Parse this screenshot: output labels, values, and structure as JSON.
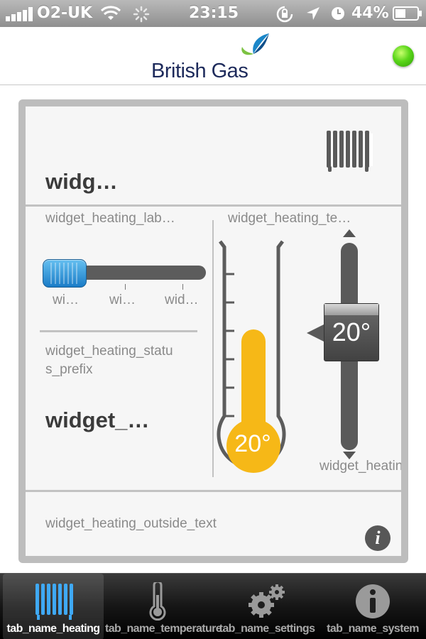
{
  "status_bar": {
    "carrier": "O2-UK",
    "time": "23:15",
    "battery": "44%"
  },
  "header": {
    "brand": "British Gas",
    "connection_color": "#5bd61a"
  },
  "widget": {
    "title": "widg…",
    "heating_label": "widget_heating_lab…",
    "slider_labels": [
      "wi…",
      "wi…",
      "wid…"
    ],
    "slider_level": 0,
    "status_prefix": "widget_heating_statu\ns_prefix",
    "status_value": "widget_…",
    "temperature_label": "widget_heating_te…",
    "thermometer_value": "20°",
    "setpoint_value": "20°",
    "heating_bottom_label": "widget_heating_",
    "outside_text": "widget_heating_outside_text",
    "accent_colors": {
      "thermometer": "#f6b817",
      "slider": "#2a8fd8"
    }
  },
  "tabs": [
    {
      "label": "tab_name_heating",
      "icon": "radiator-icon",
      "active": true
    },
    {
      "label": "tab_name_temperature",
      "icon": "thermometer-icon",
      "active": false
    },
    {
      "label": "tab_name_settings",
      "icon": "gears-icon",
      "active": false
    },
    {
      "label": "tab_name_system",
      "icon": "info-icon",
      "active": false
    }
  ]
}
